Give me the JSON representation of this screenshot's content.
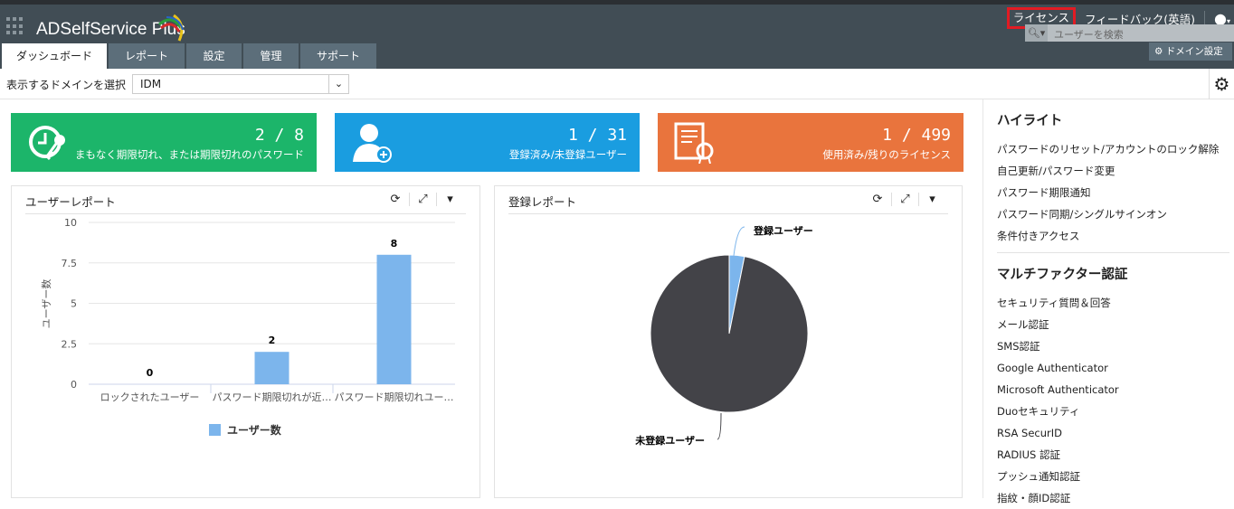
{
  "app": {
    "name": "ADSelfService Plus"
  },
  "top_links": {
    "license": "ライセンス",
    "feedback": "フィードバック(英語)"
  },
  "search": {
    "placeholder": "ユーザーを検索"
  },
  "domain_settings": "ドメイン設定",
  "tabs": [
    {
      "label": "ダッシュボード"
    },
    {
      "label": "レポート"
    },
    {
      "label": "設定"
    },
    {
      "label": "管理"
    },
    {
      "label": "サポート"
    }
  ],
  "domain_select": {
    "label": "表示するドメインを選択",
    "value": "IDM"
  },
  "cards": [
    {
      "value": "2 / 8",
      "label": "まもなく期限切れ、または期限切れのパスワード",
      "color": "#1cb56a"
    },
    {
      "value": "1 / 31",
      "label": "登録済み/未登録ユーザー",
      "color": "#1a9de0"
    },
    {
      "value": "1 / 499",
      "label": "使用済み/残りのライセンス",
      "color": "#e9743d"
    }
  ],
  "user_report": {
    "title": "ユーザーレポート"
  },
  "enroll_report": {
    "title": "登録レポート"
  },
  "chart_data": [
    {
      "type": "bar",
      "title": "ユーザーレポート",
      "categories": [
        "ロックされたユーザー",
        "パスワード期限切れが近…",
        "パスワード期限切れユー…"
      ],
      "values": [
        0,
        2,
        8
      ],
      "ylabel": "ユーザー数",
      "ylim": [
        0,
        10
      ],
      "yticks": [
        "0",
        "2.5",
        "5",
        "7.5",
        "10"
      ],
      "legend": "ユーザー数",
      "color": "#7cb5ec"
    },
    {
      "type": "pie",
      "title": "登録レポート",
      "labels": [
        "登録ユーザー",
        "未登録ユーザー"
      ],
      "values": [
        1,
        31
      ],
      "colors": [
        "#7cb5ec",
        "#434348"
      ]
    }
  ],
  "sidebar": {
    "highlights_title": "ハイライト",
    "highlights": [
      "パスワードのリセット/アカウントのロック解除",
      "自己更新/パスワード変更",
      "パスワード期限通知",
      "パスワード同期/シングルサインオン",
      "条件付きアクセス"
    ],
    "mfa_title": "マルチファクター認証",
    "mfa": [
      "セキュリティ質問＆回答",
      "メール認証",
      "SMS認証",
      "Google Authenticator",
      "Microsoft Authenticator",
      "Duoセキュリティ",
      "RSA SecurID",
      "RADIUS 認証",
      "プッシュ通知認証",
      "指紋・顔ID認証"
    ]
  }
}
